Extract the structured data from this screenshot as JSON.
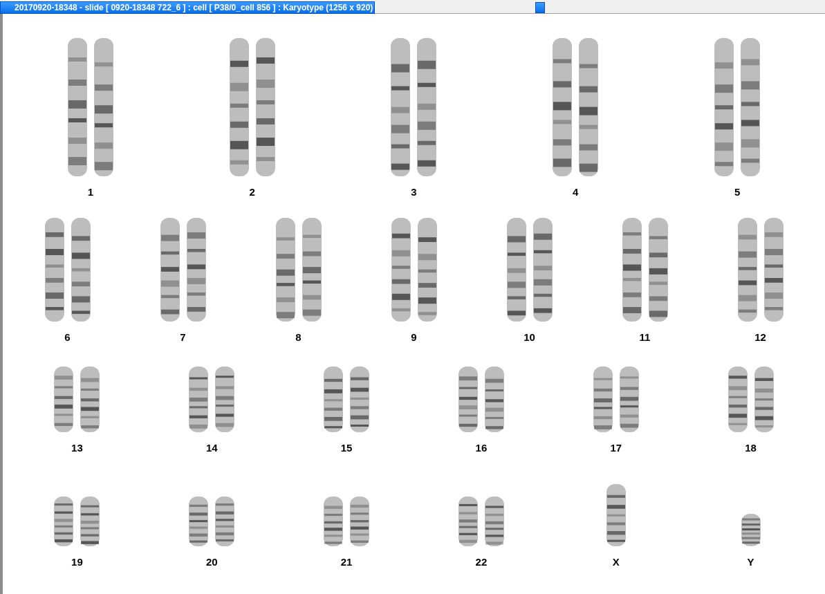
{
  "window": {
    "title": "20170920-18348 - slide [ 0920-18348 722_6 ] : cell [ P38/0_cell 856 ] : Karyotype  (1256 x 920)"
  },
  "karyotype": {
    "rows": [
      [
        {
          "label": "1",
          "kind": "pair"
        },
        {
          "label": "2",
          "kind": "pair"
        },
        {
          "label": "3",
          "kind": "pair"
        },
        {
          "label": "4",
          "kind": "pair"
        },
        {
          "label": "5",
          "kind": "pair"
        }
      ],
      [
        {
          "label": "6",
          "kind": "pair"
        },
        {
          "label": "7",
          "kind": "pair"
        },
        {
          "label": "8",
          "kind": "pair"
        },
        {
          "label": "9",
          "kind": "pair"
        },
        {
          "label": "10",
          "kind": "pair"
        },
        {
          "label": "11",
          "kind": "pair"
        },
        {
          "label": "12",
          "kind": "pair"
        }
      ],
      [
        {
          "label": "13",
          "kind": "pair"
        },
        {
          "label": "14",
          "kind": "pair"
        },
        {
          "label": "15",
          "kind": "pair"
        },
        {
          "label": "16",
          "kind": "pair"
        },
        {
          "label": "17",
          "kind": "pair"
        },
        {
          "label": "18",
          "kind": "pair"
        }
      ],
      [
        {
          "label": "19",
          "kind": "pair"
        },
        {
          "label": "20",
          "kind": "pair"
        },
        {
          "label": "21",
          "kind": "pair"
        },
        {
          "label": "22",
          "kind": "pair"
        },
        {
          "label": "X",
          "kind": "single"
        },
        {
          "label": "Y",
          "kind": "small-single"
        }
      ]
    ]
  }
}
